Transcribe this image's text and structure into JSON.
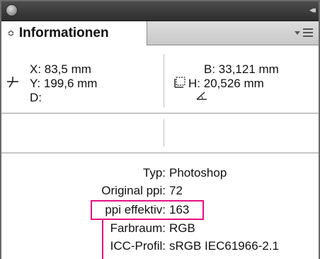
{
  "panel": {
    "tab_label": "Informationen",
    "tab_arrows": "≎",
    "collapse_glyph": "◂◂"
  },
  "position": {
    "x_label": "X:",
    "x_value": "83,5 mm",
    "y_label": "Y:",
    "y_value": "199,6 mm",
    "d_label": "D:",
    "d_value": ""
  },
  "size": {
    "w_label": "B:",
    "w_value": "33,121 mm",
    "h_label": "H:",
    "h_value": "20,526 mm"
  },
  "metadata": [
    {
      "label": "Typ:",
      "value": "Photoshop"
    },
    {
      "label": "Original ppi:",
      "value": "72"
    },
    {
      "label": "ppi effektiv:",
      "value": "163"
    },
    {
      "label": "Farbraum:",
      "value": "RGB"
    },
    {
      "label": "ICC-Profil:",
      "value": "sRGB IEC61966-2.1"
    }
  ],
  "colors": {
    "highlight": "#e6127f",
    "titlebar": "#3a3a3a",
    "tabbar": "#d0d0d0"
  },
  "icons": {
    "close": "close-icon",
    "collapse": "collapse-icon",
    "panel_menu": "panel-menu-icon",
    "position": "crosshair-icon",
    "size": "resize-icon",
    "angle": "angle-icon"
  }
}
